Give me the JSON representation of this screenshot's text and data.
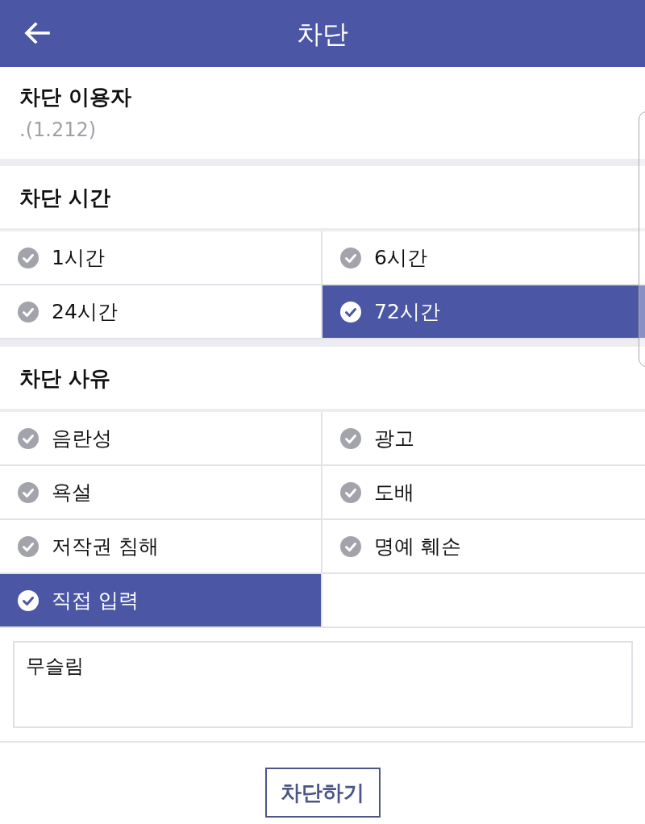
{
  "header": {
    "title": "차단"
  },
  "blocked_user": {
    "label": "차단 이용자",
    "value": ".(1.212)"
  },
  "duration": {
    "label": "차단 시간",
    "options": [
      {
        "label": "1시간",
        "selected": false
      },
      {
        "label": "6시간",
        "selected": false
      },
      {
        "label": "24시간",
        "selected": false
      },
      {
        "label": "72시간",
        "selected": true
      }
    ]
  },
  "reason": {
    "label": "차단 사유",
    "options": [
      {
        "label": "음란성",
        "selected": false
      },
      {
        "label": "광고",
        "selected": false
      },
      {
        "label": "욕설",
        "selected": false
      },
      {
        "label": "도배",
        "selected": false
      },
      {
        "label": "저작권 침해",
        "selected": false
      },
      {
        "label": "명예 훼손",
        "selected": false
      },
      {
        "label": "직접 입력",
        "selected": true
      }
    ],
    "custom_text": "무슬림"
  },
  "submit_button": "차단하기"
}
